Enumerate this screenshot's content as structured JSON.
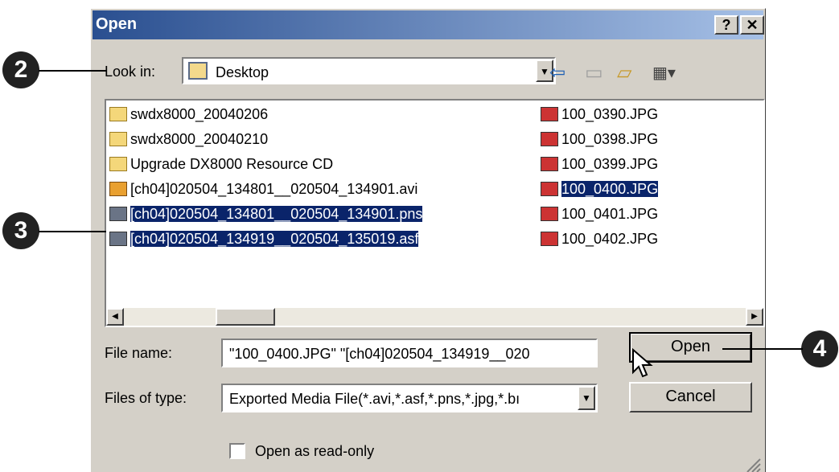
{
  "dialog": {
    "title": "Open",
    "help_label": "?",
    "close_label": "✕",
    "look_in_label": "Look in:",
    "look_in_value": "Desktop",
    "files_left": [
      {
        "name": "swdx8000_20040206",
        "icon": "folder-icon",
        "selected": false
      },
      {
        "name": "swdx8000_20040210",
        "icon": "folder-icon",
        "selected": false
      },
      {
        "name": "Upgrade DX8000 Resource CD",
        "icon": "folder-icon",
        "selected": false
      },
      {
        "name": "[ch04]020504_134801__020504_134901.avi",
        "icon": "video-file-icon",
        "selected": false
      },
      {
        "name": "[ch04]020504_134801__020504_134901.pns",
        "icon": "pns-file-icon",
        "selected": true
      },
      {
        "name": "[ch04]020504_134919__020504_135019.asf",
        "icon": "asf-file-icon",
        "selected": true
      }
    ],
    "files_right": [
      {
        "name": "100_0390.JPG",
        "icon": "image-file-icon",
        "selected": false
      },
      {
        "name": "100_0398.JPG",
        "icon": "image-file-icon",
        "selected": false
      },
      {
        "name": "100_0399.JPG",
        "icon": "image-file-icon",
        "selected": false
      },
      {
        "name": "100_0400.JPG",
        "icon": "image-file-icon",
        "selected": true
      },
      {
        "name": "100_0401.JPG",
        "icon": "image-file-icon",
        "selected": false
      },
      {
        "name": "100_0402.JPG",
        "icon": "image-file-icon",
        "selected": false
      }
    ],
    "file_name_label": "File name:",
    "file_name_value": "\"100_0400.JPG\" \"[ch04]020504_134919__020",
    "files_of_type_label": "Files of type:",
    "files_of_type_value": "Exported Media File(*.avi,*.asf,*.pns,*.jpg,*.bı",
    "open_button": "Open",
    "cancel_button": "Cancel",
    "read_only_label": "Open as read-only",
    "colors": {
      "titlebar": "#2a4f90",
      "selection": "#0a246a",
      "face": "#d4d0c8"
    }
  },
  "callouts": [
    "2",
    "3",
    "4"
  ]
}
